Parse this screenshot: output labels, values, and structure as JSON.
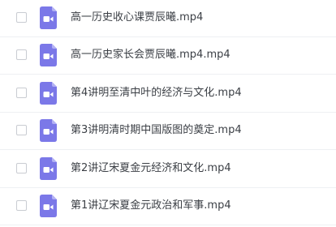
{
  "files": [
    {
      "name": "高一历史收心课贾辰曦.mp4",
      "icon": "video-file-icon"
    },
    {
      "name": "高一历史家长会贾辰曦.mp4.mp4",
      "icon": "video-file-icon"
    },
    {
      "name": "第4讲明至清中叶的经济与文化.mp4",
      "icon": "video-file-icon"
    },
    {
      "name": "第3讲明清时期中国版图的奠定.mp4",
      "icon": "video-file-icon"
    },
    {
      "name": "第2讲辽宋夏金元经济和文化.mp4",
      "icon": "video-file-icon"
    },
    {
      "name": "第1讲辽宋夏金元政治和军事.mp4",
      "icon": "video-file-icon"
    }
  ],
  "colors": {
    "icon_bg": "#7b78e8",
    "icon_fold": "#b3b1f4",
    "text": "#3b3f45",
    "divider": "#eef0f3"
  }
}
